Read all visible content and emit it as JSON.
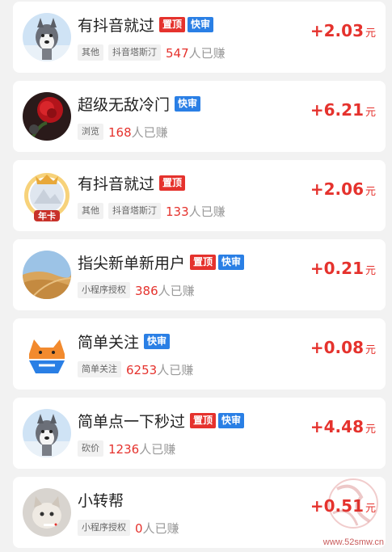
{
  "tasks": [
    {
      "title": "有抖音就过",
      "badges": [
        "置顶",
        "快审"
      ],
      "tags": [
        "其他",
        "抖音塔斯汀"
      ],
      "earned_count": "547",
      "earned_suffix": "人已赚",
      "amount": "+2.03",
      "unit": "元",
      "avatar": "husky-dog-avatar"
    },
    {
      "title": "超级无敌冷门",
      "badges": [
        "快审"
      ],
      "tags": [
        "浏览"
      ],
      "earned_count": "168",
      "earned_suffix": "人已赚",
      "amount": "+6.21",
      "unit": "元",
      "avatar": "red-rose-avatar"
    },
    {
      "title": "有抖音就过",
      "badges": [
        "置顶"
      ],
      "tags": [
        "其他",
        "抖音塔斯汀"
      ],
      "earned_count": "133",
      "earned_suffix": "人已赚",
      "amount": "+2.06",
      "unit": "元",
      "avatar": "annual-card-frame-avatar",
      "avatar_badge": "年卡"
    },
    {
      "title": "指尖新单新用户",
      "badges": [
        "置顶",
        "快审"
      ],
      "tags": [
        "小程序授权"
      ],
      "earned_count": "386",
      "earned_suffix": "人已赚",
      "amount": "+0.21",
      "unit": "元",
      "avatar": "desert-dune-avatar"
    },
    {
      "title": "简单关注",
      "badges": [
        "快审"
      ],
      "tags": [
        "简单关注"
      ],
      "earned_count": "6253",
      "earned_suffix": "人已赚",
      "amount": "+0.08",
      "unit": "元",
      "avatar": "cartoon-cat-avatar"
    },
    {
      "title": "简单点一下秒过",
      "badges": [
        "置顶",
        "快审"
      ],
      "tags": [
        "砍价"
      ],
      "earned_count": "1236",
      "earned_suffix": "人已赚",
      "amount": "+4.48",
      "unit": "元",
      "avatar": "husky-dog-avatar"
    },
    {
      "title": "小转帮",
      "badges": [],
      "tags": [
        "小程序授权"
      ],
      "earned_count": "0",
      "earned_suffix": "人已赚",
      "amount": "+0.51",
      "unit": "元",
      "avatar": "cat-photo-avatar"
    }
  ],
  "watermark": {
    "site": "www.52smw.cn"
  },
  "colors": {
    "accent_red": "#e5322d",
    "badge_blue": "#2a7fe5",
    "background": "#f2f2f2"
  }
}
